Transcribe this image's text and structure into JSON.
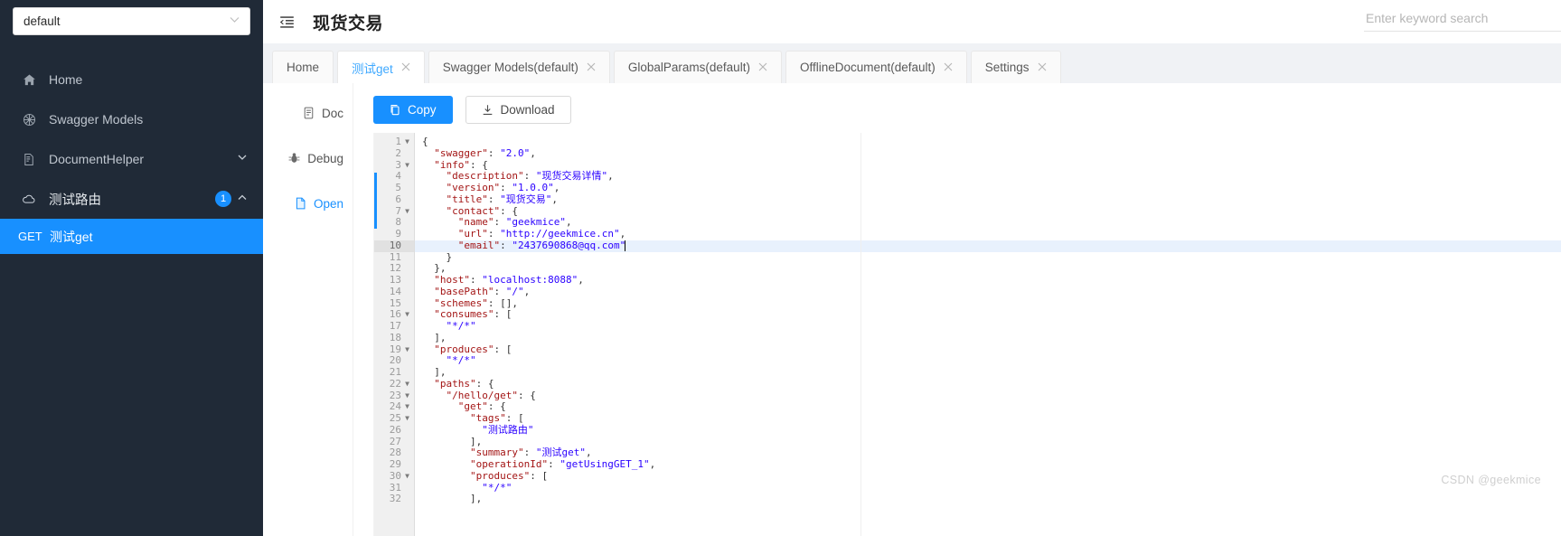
{
  "sidebar": {
    "project_select": {
      "value": "default",
      "caret_icon": "chevron-down-icon"
    },
    "items": [
      {
        "label": "Home",
        "icon": "home-icon",
        "badge": null,
        "chevron": null
      },
      {
        "label": "Swagger Models",
        "icon": "model-icon",
        "badge": null,
        "chevron": null
      },
      {
        "label": "DocumentHelper",
        "icon": "document-icon",
        "badge": null,
        "chevron": "⌄"
      },
      {
        "label": "测试路由",
        "icon": "cloud-icon",
        "badge": "1",
        "chevron": "⌃"
      }
    ],
    "api_row": {
      "method": "GET",
      "name": "测试get"
    }
  },
  "header": {
    "collapse_icon": "menu-collapse-icon",
    "title": "现货交易",
    "search": {
      "placeholder": "Enter keyword search",
      "value": ""
    }
  },
  "tabs": [
    {
      "label": "Home",
      "closable": false,
      "active": false
    },
    {
      "label": "测试get",
      "closable": true,
      "active": true
    },
    {
      "label": "Swagger Models(default)",
      "closable": true,
      "active": false
    },
    {
      "label": "GlobalParams(default)",
      "closable": true,
      "active": false
    },
    {
      "label": "OfflineDocument(default)",
      "closable": true,
      "active": false
    },
    {
      "label": "Settings",
      "closable": true,
      "active": false
    }
  ],
  "doc_menu": [
    {
      "label": "Doc",
      "icon": "doc-icon",
      "active": false
    },
    {
      "label": "Debug",
      "icon": "bug-icon",
      "active": false
    },
    {
      "label": "Open",
      "icon": "file-icon",
      "active": true
    }
  ],
  "toolbar": {
    "copy_label": "Copy",
    "copy_icon": "copy-icon",
    "download_label": "Download",
    "download_icon": "download-icon"
  },
  "editor": {
    "current_line": 10,
    "total_visible_lines": 32,
    "lines": [
      {
        "n": 1,
        "fold": true,
        "text": "{"
      },
      {
        "n": 2,
        "fold": false,
        "text": "  \"swagger\": \"2.0\","
      },
      {
        "n": 3,
        "fold": true,
        "text": "  \"info\": {"
      },
      {
        "n": 4,
        "fold": false,
        "text": "    \"description\": \"现货交易详情\","
      },
      {
        "n": 5,
        "fold": false,
        "text": "    \"version\": \"1.0.0\","
      },
      {
        "n": 6,
        "fold": false,
        "text": "    \"title\": \"现货交易\","
      },
      {
        "n": 7,
        "fold": true,
        "text": "    \"contact\": {"
      },
      {
        "n": 8,
        "fold": false,
        "text": "      \"name\": \"geekmice\","
      },
      {
        "n": 9,
        "fold": false,
        "text": "      \"url\": \"http://geekmice.cn\","
      },
      {
        "n": 10,
        "fold": false,
        "text": "      \"email\": \"2437690868@qq.com\""
      },
      {
        "n": 11,
        "fold": false,
        "text": "    }"
      },
      {
        "n": 12,
        "fold": false,
        "text": "  },"
      },
      {
        "n": 13,
        "fold": false,
        "text": "  \"host\": \"localhost:8088\","
      },
      {
        "n": 14,
        "fold": false,
        "text": "  \"basePath\": \"/\","
      },
      {
        "n": 15,
        "fold": false,
        "text": "  \"schemes\": [],"
      },
      {
        "n": 16,
        "fold": true,
        "text": "  \"consumes\": ["
      },
      {
        "n": 17,
        "fold": false,
        "text": "    \"*/*\""
      },
      {
        "n": 18,
        "fold": false,
        "text": "  ],"
      },
      {
        "n": 19,
        "fold": true,
        "text": "  \"produces\": ["
      },
      {
        "n": 20,
        "fold": false,
        "text": "    \"*/*\""
      },
      {
        "n": 21,
        "fold": false,
        "text": "  ],"
      },
      {
        "n": 22,
        "fold": true,
        "text": "  \"paths\": {"
      },
      {
        "n": 23,
        "fold": true,
        "text": "    \"/hello/get\": {"
      },
      {
        "n": 24,
        "fold": true,
        "text": "      \"get\": {"
      },
      {
        "n": 25,
        "fold": true,
        "text": "        \"tags\": ["
      },
      {
        "n": 26,
        "fold": false,
        "text": "          \"测试路由\""
      },
      {
        "n": 27,
        "fold": false,
        "text": "        ],"
      },
      {
        "n": 28,
        "fold": false,
        "text": "        \"summary\": \"测试get\","
      },
      {
        "n": 29,
        "fold": false,
        "text": "        \"operationId\": \"getUsingGET_1\","
      },
      {
        "n": 30,
        "fold": true,
        "text": "        \"produces\": ["
      },
      {
        "n": 31,
        "fold": false,
        "text": "          \"*/*\""
      },
      {
        "n": 32,
        "fold": false,
        "text": "        ],"
      }
    ]
  },
  "watermark": {
    "text": "CSDN @geekmice"
  },
  "colors": {
    "sidebar_bg": "#202A37",
    "accent": "#1890ff",
    "tab_bg": "#f0f2f5",
    "gutter_bg": "#f0f0f0",
    "active_line": "#e8f1fd",
    "string_color": "#2a00ff",
    "key_color": "#a31515"
  }
}
